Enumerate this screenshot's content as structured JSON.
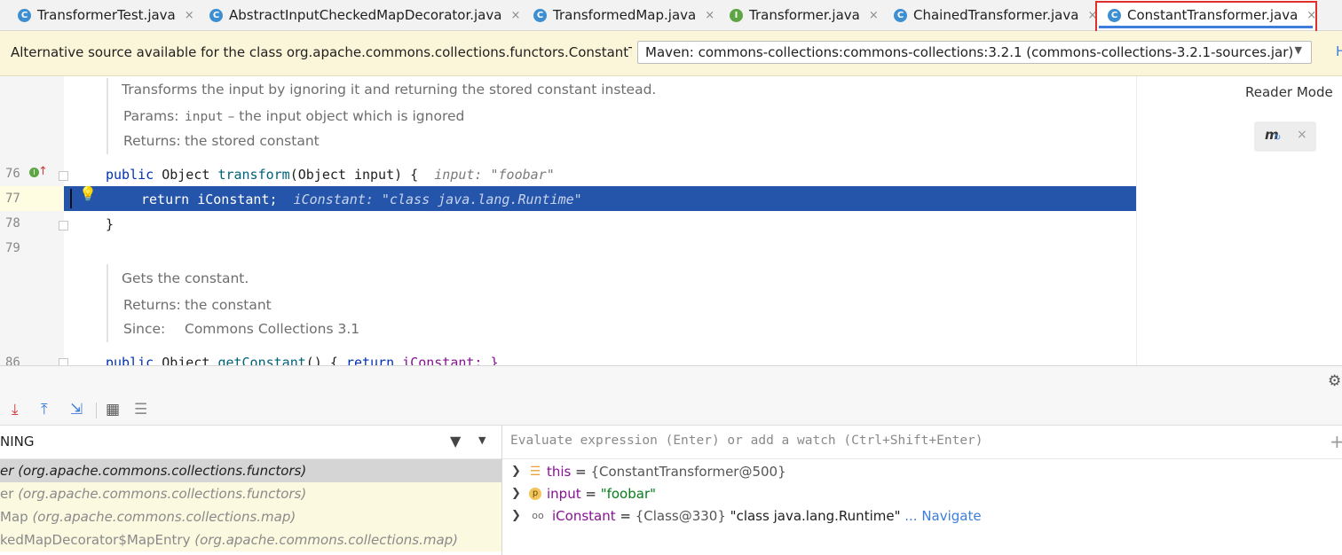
{
  "tabs": [
    {
      "label": "TransformerTest.java",
      "icon": "class-icon",
      "icon_letter": "C"
    },
    {
      "label": "AbstractInputCheckedMapDecorator.java",
      "icon": "class-icon",
      "icon_letter": "C"
    },
    {
      "label": "TransformedMap.java",
      "icon": "class-icon",
      "icon_letter": "C"
    },
    {
      "label": "Transformer.java",
      "icon": "interface-icon",
      "icon_letter": "I"
    },
    {
      "label": "ChainedTransformer.java",
      "icon": "class-icon",
      "icon_letter": "C"
    },
    {
      "label": "ConstantTransformer.java",
      "icon": "class-icon",
      "icon_letter": "C",
      "active": true
    }
  ],
  "tab_close_glyph": "×",
  "banner": {
    "message": "Alternative source available for the class org.apache.commons.collections.functors.ConstantTran",
    "source_select": "Maven: commons-collections:commons-collections:3.2.1 (commons-collections-3.2.1-sources.jar)",
    "trailing": "H"
  },
  "editor": {
    "doc1": {
      "summary": "Transforms the input by ignoring it and returning the stored constant instead.",
      "params_label": "Params:",
      "params_name": "input",
      "params_desc": " – the input object which is ignored",
      "returns_label": "Returns:",
      "returns_desc": "the stored constant"
    },
    "lines": [
      {
        "num": "76",
        "kw": "public",
        "text1": " Object ",
        "fn": "transform",
        "text2": "(Object input) {",
        "hint": "input: \"foobar\""
      },
      {
        "num": "77",
        "kw": "return",
        "text1": " iConstant;",
        "hint": "iConstant: \"class java.lang.Runtime\""
      },
      {
        "num": "78",
        "text": "}"
      },
      {
        "num": "79",
        "text": ""
      }
    ],
    "doc2": {
      "summary": "Gets the constant.",
      "returns_label": "Returns:",
      "returns_desc": "the constant",
      "since_label": "Since:",
      "since_desc": "Commons Collections 3.1"
    },
    "line86": {
      "num": "86",
      "kw": "public",
      "text1": " Object ",
      "fn": "getConstant",
      "text2": "() { ",
      "kw2": "return",
      "text3": " iConstant; }"
    },
    "reader_mode": "Reader Mode",
    "reader_icon": "m",
    "reader_close": "×"
  },
  "debugger": {
    "frames_state": "NING",
    "frames": [
      {
        "name": "er",
        "pkg": "(org.apache.commons.collections.functors)",
        "selected": true
      },
      {
        "name": "er",
        "pkg": "(org.apache.commons.collections.functors)"
      },
      {
        "name": "Map",
        "pkg": "(org.apache.commons.collections.map)"
      },
      {
        "name": "kedMapDecorator$MapEntry",
        "pkg": "(org.apache.commons.collections.map)"
      }
    ],
    "watch_placeholder": "Evaluate expression (Enter) or add a watch (Ctrl+Shift+Enter)",
    "variables": [
      {
        "icon": "field-icon",
        "name": "this",
        "eq": " = ",
        "value": "{ConstantTransformer@500}"
      },
      {
        "icon": "parameter-icon",
        "icon_letter": "p",
        "name": "input",
        "eq": " = ",
        "value": "\"foobar\""
      },
      {
        "icon": "watch-glasses-icon",
        "name": "iConstant",
        "eq": " = ",
        "value": "{Class@330}",
        "extra": " \"class java.lang.Runtime\"",
        "nav": " ... Navigate"
      }
    ]
  },
  "colors": {
    "execution_line": "#2555aa",
    "active_tab_underline": "#3d7ddc",
    "highlight_frame": "#e0302b"
  }
}
